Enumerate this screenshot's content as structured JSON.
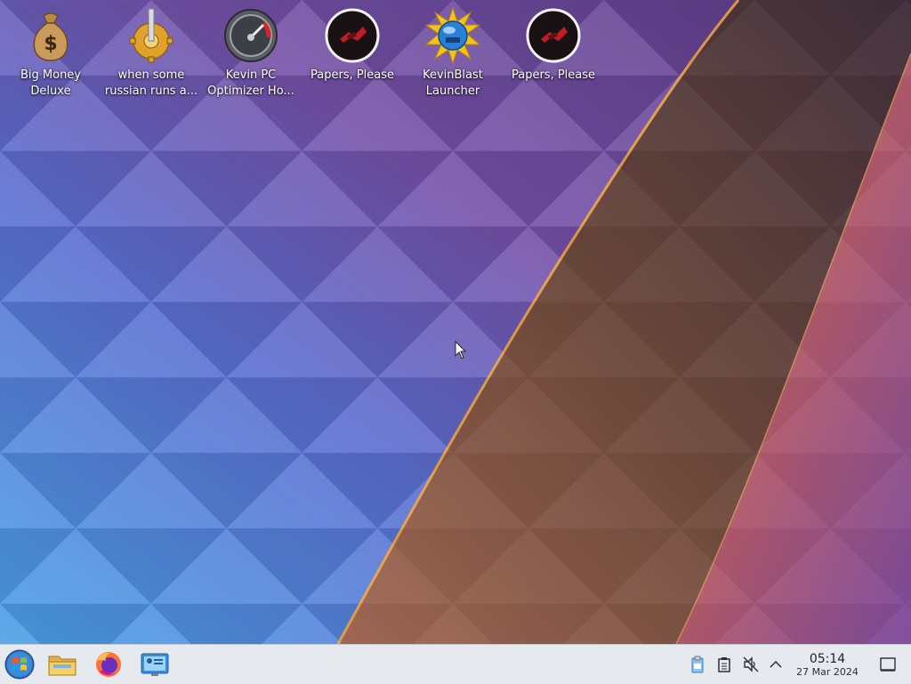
{
  "desktop": {
    "icons": [
      {
        "label": "Big Money\nDeluxe",
        "icon": "money-bag-icon"
      },
      {
        "label": "when some\nrussian runs a...",
        "icon": "gear-icon"
      },
      {
        "label": "Kevin PC\nOptimizer Ho...",
        "icon": "speedometer-icon"
      },
      {
        "label": "Papers, Please",
        "icon": "papers-please-icon"
      },
      {
        "label": "KevinBlast\nLauncher",
        "icon": "globe-burst-icon"
      },
      {
        "label": "Papers, Please",
        "icon": "papers-please-icon"
      }
    ]
  },
  "taskbar": {
    "buttons": [
      "start-menu-icon",
      "file-manager-icon",
      "firefox-icon",
      "system-settings-icon"
    ],
    "tray": [
      "clipboard-icon",
      "notes-icon",
      "volume-muted-icon",
      "show-hidden-icon",
      "show-desktop-icon"
    ],
    "clock": {
      "time": "05:14",
      "date": "27 Mar 2024"
    }
  },
  "colors": {
    "taskbar_bg": "#e6e9ee",
    "wallpaper_blue": "#4a7ad8",
    "wallpaper_purple": "#6a3f9a",
    "wallpaper_orange": "#e0883a"
  }
}
